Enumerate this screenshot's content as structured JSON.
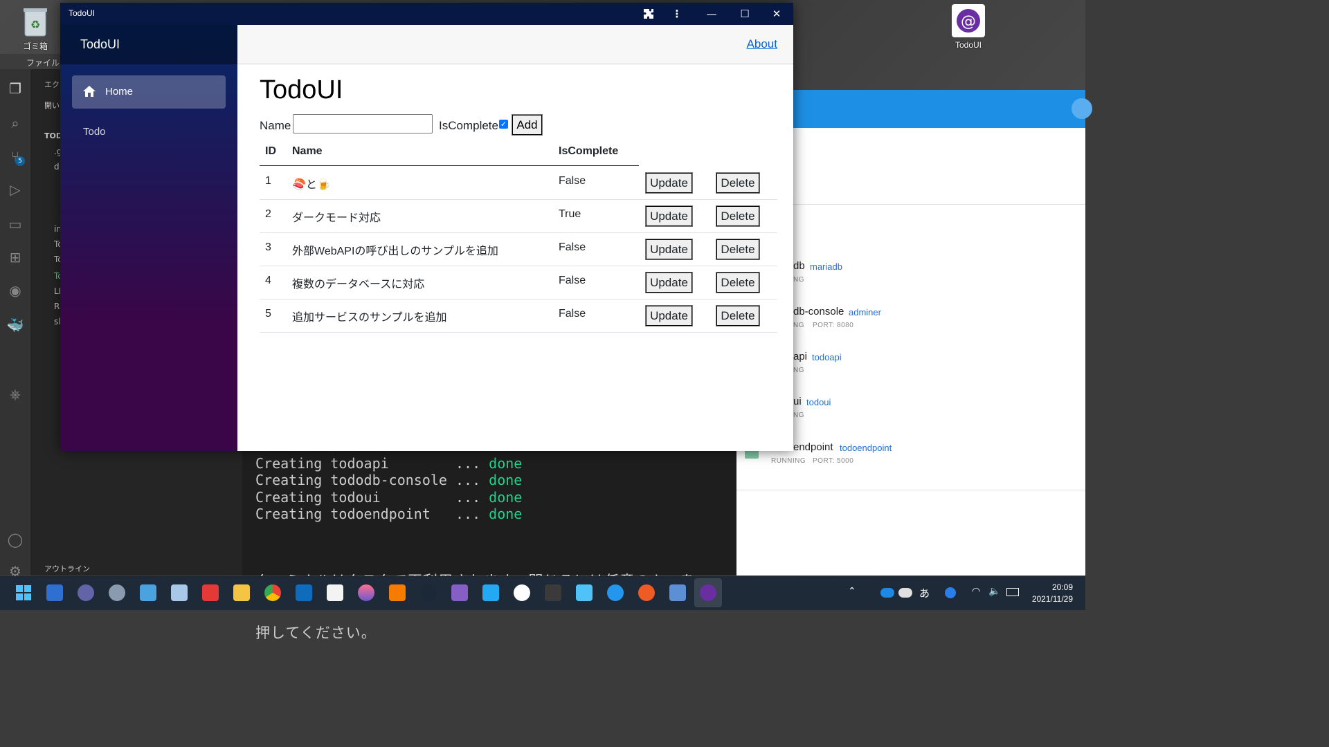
{
  "desktop": {
    "recycle_bin_label": "ゴミ箱",
    "shortcut_label": "TodoUI"
  },
  "vscode": {
    "menu_file": "ファイル(F",
    "explorer_header": "エクス",
    "open_editors": "開い",
    "folder": "TOD",
    "outline": "アウトライン",
    "tree_items": [
      ".g",
      "d",
      "in",
      "To",
      "To",
      "To",
      "LI",
      "R",
      "sl"
    ],
    "scm_badge": "5"
  },
  "terminal": {
    "lines": [
      {
        "name": "Creating todoapi        ",
        "dots": "... ",
        "status": "done"
      },
      {
        "name": "Creating tododb-console ",
        "dots": "... ",
        "status": "done"
      },
      {
        "name": "Creating todoui         ",
        "dots": "... ",
        "status": "done"
      },
      {
        "name": "Creating todoendpoint   ",
        "dots": "... ",
        "status": "done"
      }
    ],
    "message_1": "ターミナルはタスクで再利用されます、閉じるには任意のキーを",
    "message_2": "押してください。"
  },
  "docker": {
    "containers": [
      {
        "name": "db",
        "image": "mariadb",
        "status": "NG",
        "port": ""
      },
      {
        "name": "db-console",
        "image": "adminer",
        "status": "NG",
        "port": "PORT: 8080"
      },
      {
        "name": "api",
        "image": "todoapi",
        "status": "NG",
        "port": ""
      },
      {
        "name": "ui",
        "image": "todoui",
        "status": "NG",
        "port": ""
      },
      {
        "name": "endpoint",
        "image": "todoendpoint",
        "status": "RUNNING",
        "port": "PORT: 5000"
      }
    ]
  },
  "window": {
    "title": "TodoUI"
  },
  "sidebar": {
    "brand": "TodoUI",
    "items": [
      {
        "label": "Home",
        "icon": "home-icon",
        "active": true
      },
      {
        "label": "Todo",
        "active": false
      }
    ]
  },
  "topbar": {
    "about_label": "About"
  },
  "page": {
    "title": "TodoUI",
    "form": {
      "name_label": "Name",
      "name_value": "",
      "iscomplete_label": "IsComplete",
      "iscomplete_checked": true,
      "add_label": "Add"
    },
    "table": {
      "headers": [
        "ID",
        "Name",
        "IsComplete"
      ],
      "update_label": "Update",
      "delete_label": "Delete",
      "rows": [
        {
          "id": "1",
          "name": "🍣と🍺",
          "is_complete": "False"
        },
        {
          "id": "2",
          "name": "ダークモード対応",
          "is_complete": "True"
        },
        {
          "id": "3",
          "name": "外部WebAPIの呼び出しのサンプルを追加",
          "is_complete": "False"
        },
        {
          "id": "4",
          "name": "複数のデータベースに対応",
          "is_complete": "False"
        },
        {
          "id": "5",
          "name": "追加サービスのサンプルを追加",
          "is_complete": "False"
        }
      ]
    }
  },
  "taskbar": {
    "ime": "あ",
    "time": "20:09",
    "date": "2021/11/29"
  }
}
